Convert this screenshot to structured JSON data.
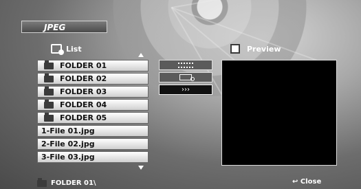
{
  "header": {
    "mode": "JPEG",
    "list_label": "List",
    "preview_label": "Preview"
  },
  "list": {
    "items": [
      {
        "type": "folder",
        "label": "FOLDER 01"
      },
      {
        "type": "folder",
        "label": "FOLDER 02"
      },
      {
        "type": "folder",
        "label": "FOLDER 03"
      },
      {
        "type": "folder",
        "label": "FOLDER 04"
      },
      {
        "type": "folder",
        "label": "FOLDER 05"
      },
      {
        "type": "file",
        "label": "1-File 01.jpg"
      },
      {
        "type": "file",
        "label": "2-File 02.jpg"
      },
      {
        "type": "file",
        "label": "3-File 03.jpg"
      }
    ]
  },
  "controls": {
    "slideshow_icon": "filmstrip-icon",
    "timer_icon": "clock-film-icon",
    "next_label": "›››"
  },
  "footer": {
    "current_folder": "FOLDER 01\\",
    "close_label": "Close"
  }
}
